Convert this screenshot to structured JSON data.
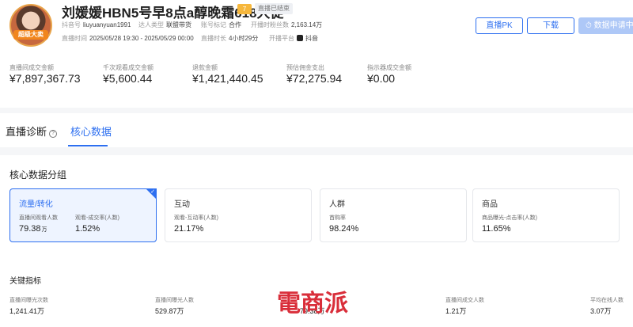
{
  "header": {
    "avatar_badge": "超级大卖",
    "title": "刘媛媛HBN5号早8点a醇晚霜618大促",
    "level": "7",
    "status": "直播已结束",
    "meta": {
      "douyin_id_label": "抖音号",
      "douyin_id": "liuyuanyuan1991",
      "talent_type_label": "达人类型",
      "talent_type": "联盟带货",
      "account_tag_label": "账号标记",
      "account_tag": "合作",
      "fans_label": "开播时粉丝数",
      "fans": "2,163.14万",
      "time_label": "直播时间",
      "time": "2025/05/28 19:30 - 2025/05/29 00:00",
      "duration_label": "直播时长",
      "duration": "4小时29分",
      "platform_label": "开播平台",
      "platform": "抖音"
    },
    "buttons": {
      "pk": "直播PK",
      "download": "下载",
      "data_apply": "数据申请中"
    }
  },
  "stats": [
    {
      "label": "直播间成交金额",
      "value": "¥7,897,367.73"
    },
    {
      "label": "千次观看成交金额",
      "value": "¥5,600.44"
    },
    {
      "label": "退款金额",
      "value": "¥1,421,440.45"
    },
    {
      "label": "预估佣金支出",
      "value": "¥72,275.94"
    },
    {
      "label": "指示器成交金额",
      "value": "¥0.00"
    }
  ],
  "tabs": [
    {
      "label": "直播诊断"
    },
    {
      "label": "核心数据"
    }
  ],
  "core": {
    "title": "核心数据分组",
    "cards": [
      {
        "name": "流量/转化",
        "m1_label": "直播间观看人数",
        "m1_value": "79.38",
        "m1_unit": "万",
        "m2_label": "观看-成交率(人数)",
        "m2_value": "1.52%"
      },
      {
        "name": "互动",
        "m1_label": "观看-互动率(人数)",
        "m1_value": "21.17%"
      },
      {
        "name": "人群",
        "m1_label": "首购率",
        "m1_value": "98.24%"
      },
      {
        "name": "商品",
        "m1_label": "商品曝光-点击率(人数)",
        "m1_value": "11.65%"
      }
    ]
  },
  "key_metrics": {
    "title": "关键指标",
    "items": [
      {
        "label": "直播间曝光次数",
        "value": "1,241.41万"
      },
      {
        "label": "直播间曝光人数",
        "value": "529.87万"
      },
      {
        "label": "",
        "value": "79.38万"
      },
      {
        "label": "直播间成交人数",
        "value": "1.21万"
      },
      {
        "label": "平均在线人数",
        "value": "3.07万"
      }
    ]
  },
  "watermark": "電商派"
}
